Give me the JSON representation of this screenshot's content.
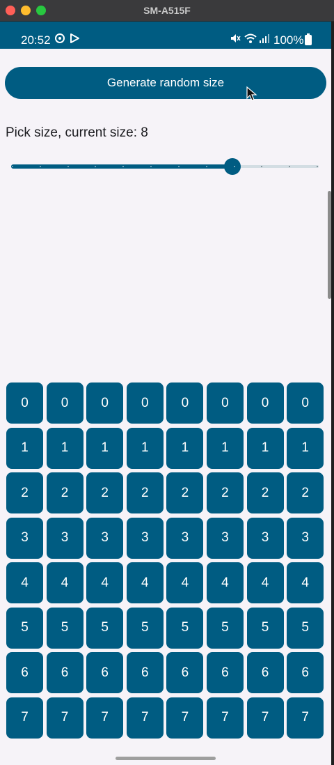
{
  "window": {
    "title": "SM-A515F"
  },
  "status_bar": {
    "time": "20:52",
    "left_icons": [
      "sync-icon",
      "play-store-icon"
    ],
    "right_icons": [
      "mute-icon",
      "wifi-icon",
      "signal-icon"
    ],
    "battery": "100%",
    "color": "#005c82"
  },
  "app": {
    "generate_button": "Generate random size",
    "size_label": "Pick size, current size: 8",
    "slider": {
      "value": 8,
      "min": 0,
      "max": 11
    },
    "grid": {
      "rows": [
        [
          "0",
          "0",
          "0",
          "0",
          "0",
          "0",
          "0",
          "0"
        ],
        [
          "1",
          "1",
          "1",
          "1",
          "1",
          "1",
          "1",
          "1"
        ],
        [
          "2",
          "2",
          "2",
          "2",
          "2",
          "2",
          "2",
          "2"
        ],
        [
          "3",
          "3",
          "3",
          "3",
          "3",
          "3",
          "3",
          "3"
        ],
        [
          "4",
          "4",
          "4",
          "4",
          "4",
          "4",
          "4",
          "4"
        ],
        [
          "5",
          "5",
          "5",
          "5",
          "5",
          "5",
          "5",
          "5"
        ],
        [
          "6",
          "6",
          "6",
          "6",
          "6",
          "6",
          "6",
          "6"
        ],
        [
          "7",
          "7",
          "7",
          "7",
          "7",
          "7",
          "7",
          "7"
        ]
      ]
    },
    "accent": "#005c82",
    "background": "#f6f3f8"
  }
}
